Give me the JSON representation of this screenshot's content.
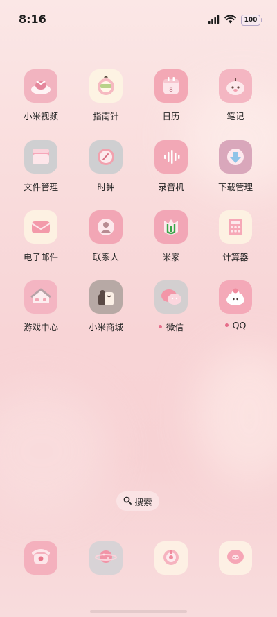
{
  "status": {
    "time": "8:16",
    "battery": "100",
    "icons": [
      "signal-icon",
      "wifi-icon",
      "battery-icon"
    ]
  },
  "apps": [
    {
      "label": "小米视频",
      "icon": "mi-video-icon",
      "dot": false
    },
    {
      "label": "指南针",
      "icon": "compass-icon",
      "dot": false
    },
    {
      "label": "日历",
      "icon": "calendar-icon",
      "dot": false
    },
    {
      "label": "笔记",
      "icon": "notes-icon",
      "dot": false
    },
    {
      "label": "文件管理",
      "icon": "file-manager-icon",
      "dot": false
    },
    {
      "label": "时钟",
      "icon": "clock-icon",
      "dot": false
    },
    {
      "label": "录音机",
      "icon": "recorder-icon",
      "dot": false
    },
    {
      "label": "下载管理",
      "icon": "download-manager-icon",
      "dot": false
    },
    {
      "label": "电子邮件",
      "icon": "email-icon",
      "dot": false
    },
    {
      "label": "联系人",
      "icon": "contacts-icon",
      "dot": false
    },
    {
      "label": "米家",
      "icon": "mi-home-icon",
      "dot": false
    },
    {
      "label": "计算器",
      "icon": "calculator-icon",
      "dot": false
    },
    {
      "label": "游戏中心",
      "icon": "game-center-icon",
      "dot": false
    },
    {
      "label": "小米商城",
      "icon": "mi-store-icon",
      "dot": false
    },
    {
      "label": "微信",
      "icon": "wechat-icon",
      "dot": true
    },
    {
      "label": "QQ",
      "icon": "qq-icon",
      "dot": true
    }
  ],
  "calendar_day": "8",
  "search": {
    "label": "搜索"
  },
  "dock": [
    {
      "icon": "phone-icon"
    },
    {
      "icon": "browser-planet-icon"
    },
    {
      "icon": "camera-apple-icon"
    },
    {
      "icon": "messages-icon"
    }
  ],
  "colors": {
    "accent_pink": "#f4a7b6",
    "notification_dot": "#e56d8a"
  }
}
